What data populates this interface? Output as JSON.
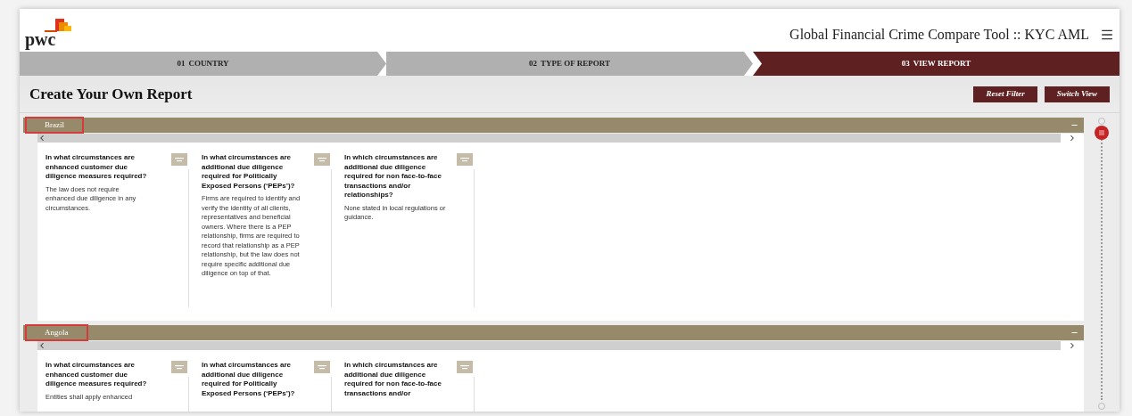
{
  "header": {
    "logo": "pwc",
    "title": "Global Financial Crime Compare Tool :: KYC AML"
  },
  "steps": [
    {
      "number": "01",
      "label": "COUNTRY",
      "selected": false
    },
    {
      "number": "02",
      "label": "TYPE OF REPORT",
      "selected": false
    },
    {
      "number": "03",
      "label": "VIEW REPORT",
      "selected": true
    }
  ],
  "page_title": "Create Your Own Report",
  "page_slider": {
    "level": 0
  },
  "buttons": [
    "Reset Filter",
    "Switch View"
  ],
  "countries": [
    {
      "name": "Brazil",
      "highlighted": true,
      "columns": [
        {
          "question": "In what circumstances are enhanced customer due diligence measures required?",
          "answer": "The law does not require enhanced due diligence in any circumstances."
        },
        {
          "question": "In what circumstances are additional due diligence required for Politically Exposed Persons (‘PEPs’)?",
          "answer": "Firms are required to identify and verify the identity of all clients, representatives and beneficial owners. Where there is a PEP relationship, firms are required to record that relationship as a PEP relationship, but the law does not require specific additional due diligence on top of that."
        },
        {
          "question": "In which circumstances are additional due diligence required for non face-to-face transactions and/or relationships?",
          "answer": "None stated in local regulations or guidance."
        }
      ]
    },
    {
      "name": "Angola",
      "highlighted": true,
      "columns": [
        {
          "question": "In what circumstances are enhanced customer due diligence measures required?",
          "answer": "Entities shall apply enhanced"
        },
        {
          "question": "In what circumstances are additional due diligence required for Politically Exposed Persons (‘PEPs’)?"
        },
        {
          "question": "In which circumstances are additional due diligence required for non face-to-face transactions and/or"
        }
      ]
    }
  ]
}
